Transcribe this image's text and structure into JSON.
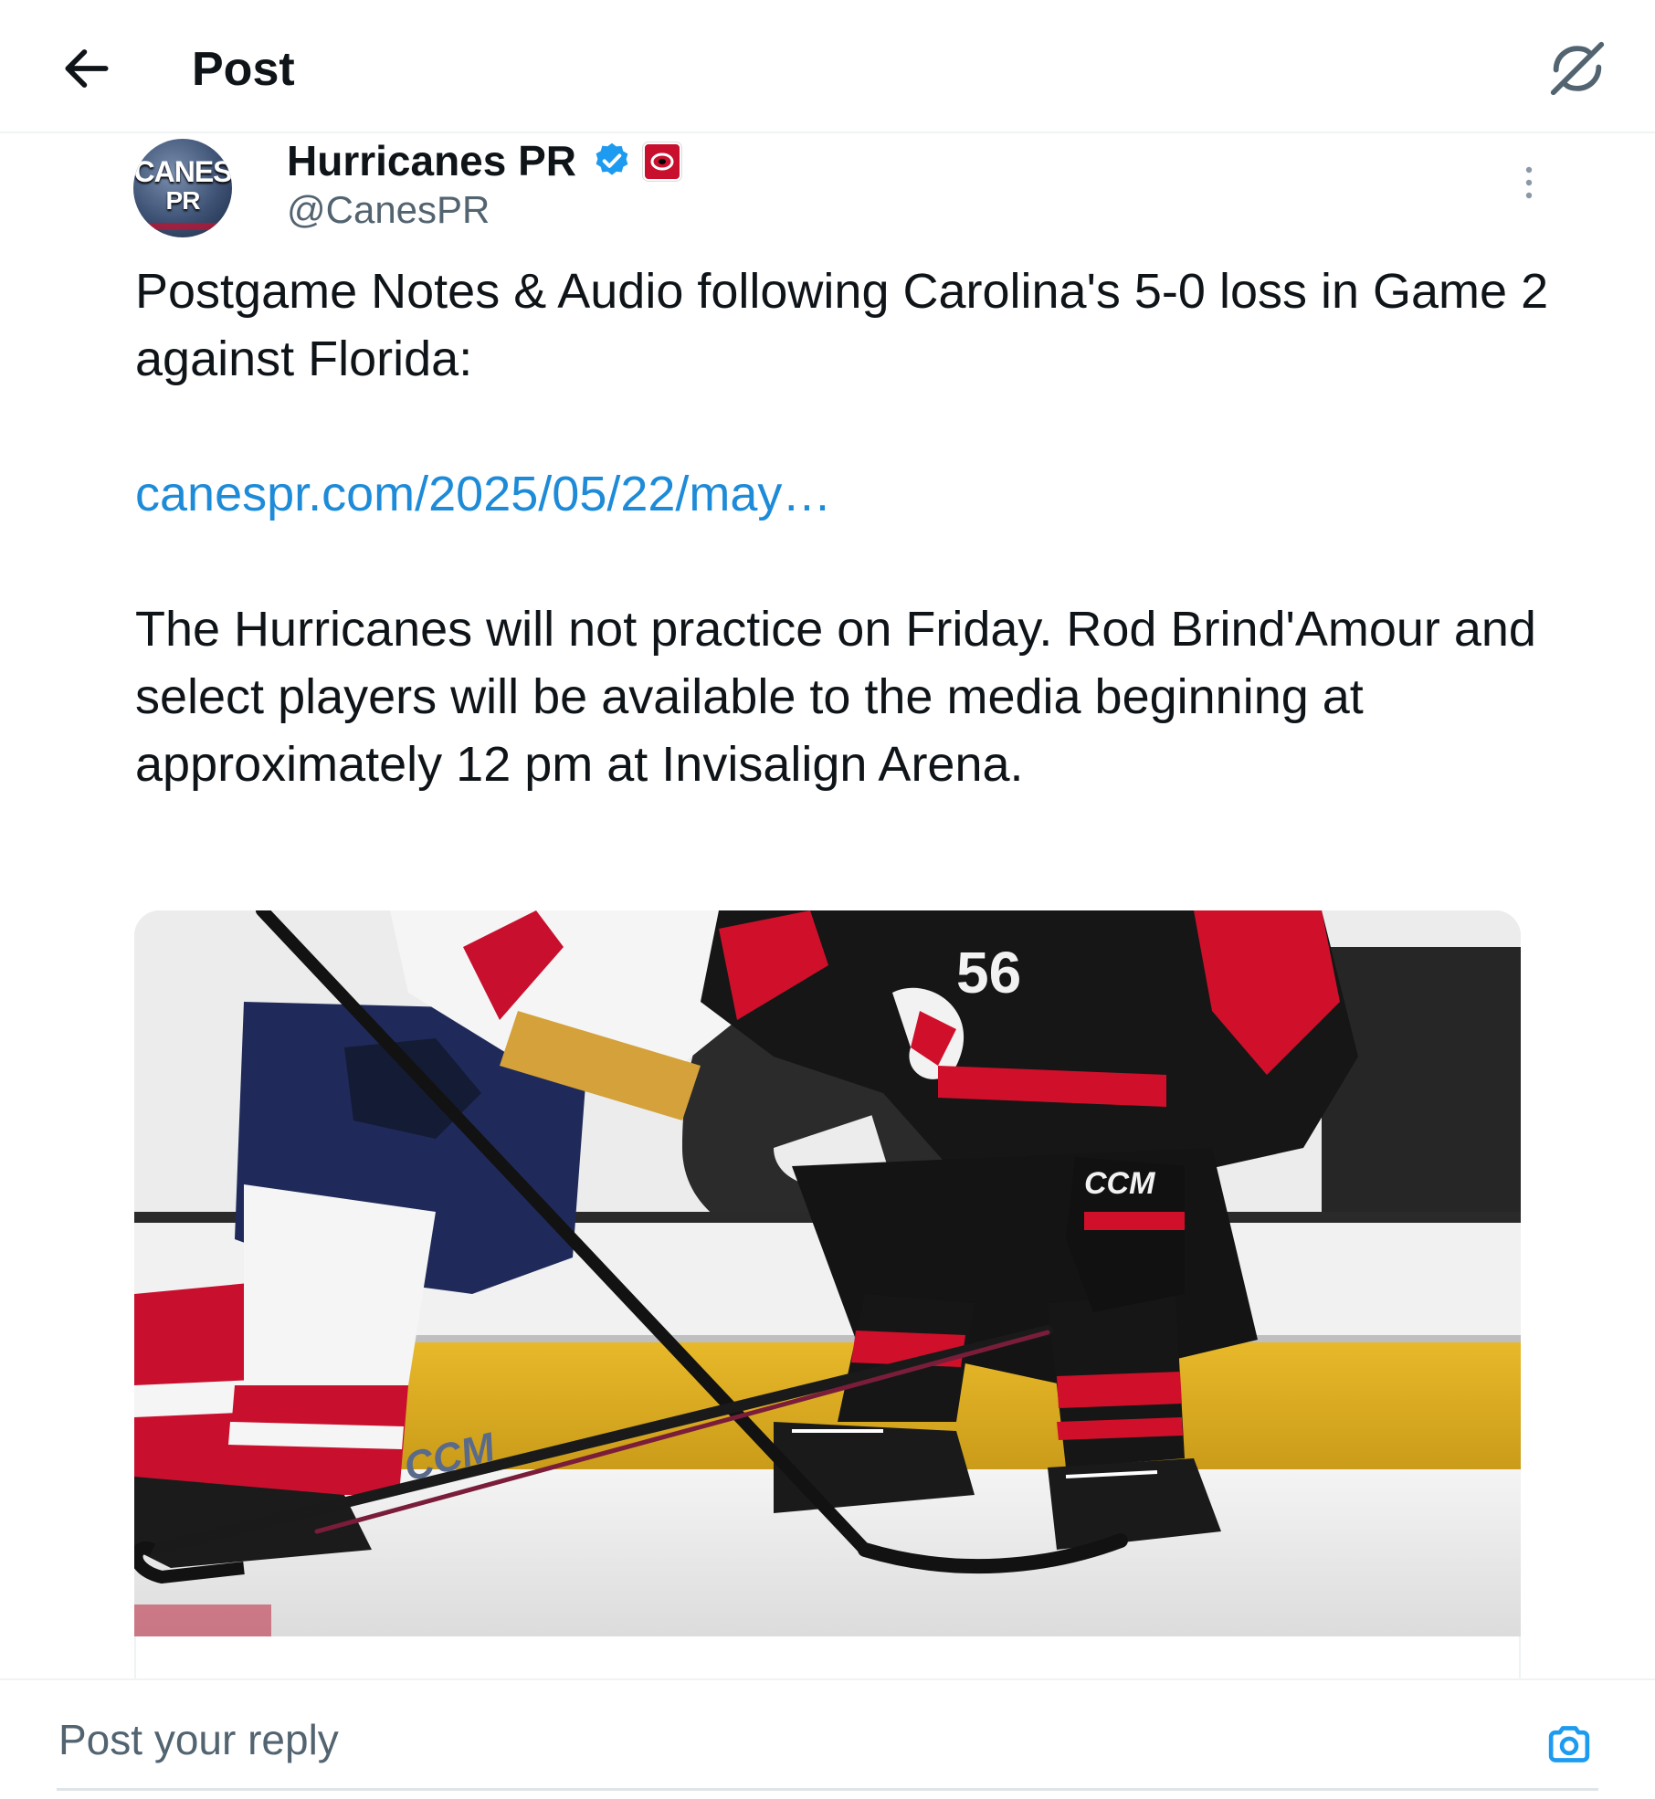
{
  "header": {
    "title": "Post",
    "back_icon": "arrow-left-icon",
    "grok_icon": "grok-icon"
  },
  "author": {
    "display_name": "Hurricanes PR",
    "handle": "@CanesPR",
    "avatar_text_line1": "CANES",
    "avatar_text_line2": "PR",
    "verified_icon": "verified-badge-icon",
    "affiliate_icon": "hurricanes-logo-icon",
    "more_icon": "more-vertical-icon"
  },
  "tweet": {
    "line1": "Postgame Notes & Audio following Carolina's 5-0 loss in Game 2 against Florida:",
    "link": "canespr.com/2025/05/22/may…",
    "line2": "The Hurricanes will not practice on Friday. Rod Brind'Amour and select players will be available to the media beginning at approximately 12 pm at Invisalign Arena."
  },
  "media": {
    "description_visible": false,
    "jersey_number": "56",
    "stick_brand": "CCM",
    "glove_brand": "CCM"
  },
  "reply": {
    "placeholder": "Post your reply",
    "camera_icon": "camera-icon"
  },
  "colors": {
    "link": "#1d8bd8",
    "verified": "#1d9bf0",
    "hurricanes_red": "#c8102e",
    "panthers_navy": "#1f2a5a"
  }
}
